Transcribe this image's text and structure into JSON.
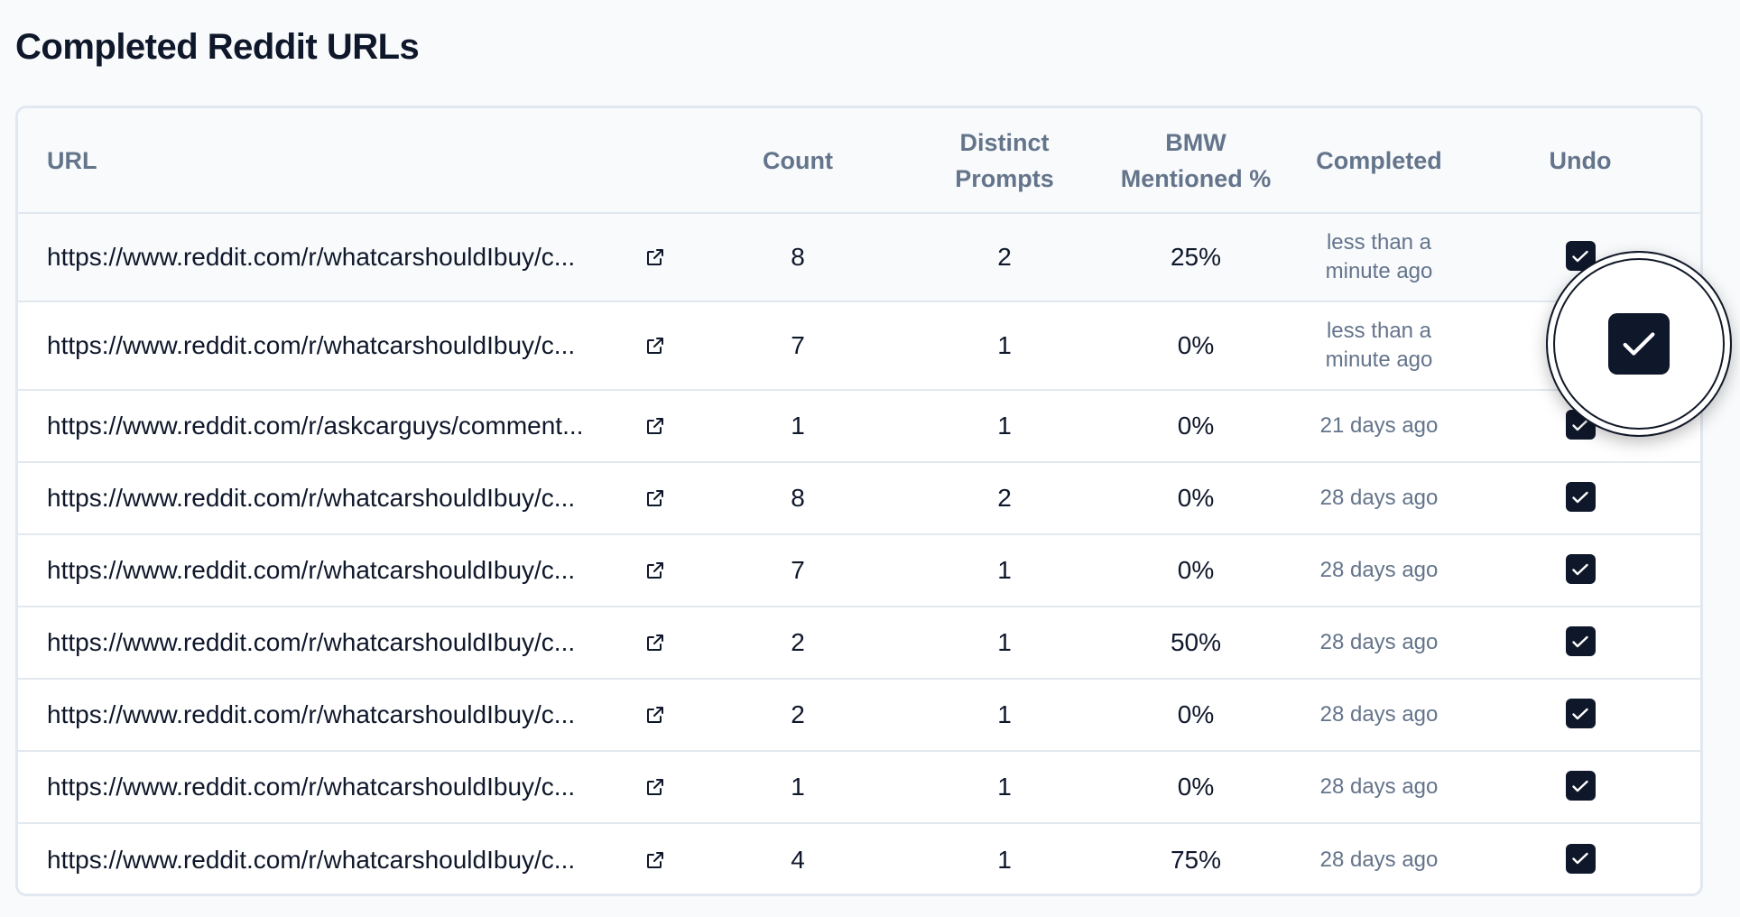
{
  "page": {
    "title": "Completed Reddit URLs"
  },
  "table": {
    "headers": {
      "url": "URL",
      "count": "Count",
      "distinct_line1": "Distinct",
      "distinct_line2": "Prompts",
      "bmw_line1": "BMW",
      "bmw_line2": "Mentioned %",
      "completed": "Completed",
      "undo": "Undo"
    },
    "rows": [
      {
        "url": "https://www.reddit.com/r/whatcarshouldIbuy/c...",
        "count": "8",
        "distinct": "2",
        "bmw": "25%",
        "completed": "less than a minute ago",
        "undo_checked": true
      },
      {
        "url": "https://www.reddit.com/r/whatcarshouldIbuy/c...",
        "count": "7",
        "distinct": "1",
        "bmw": "0%",
        "completed": "less than a minute ago",
        "undo_checked": true
      },
      {
        "url": "https://www.reddit.com/r/askcarguys/comment...",
        "count": "1",
        "distinct": "1",
        "bmw": "0%",
        "completed": "21 days ago",
        "undo_checked": true
      },
      {
        "url": "https://www.reddit.com/r/whatcarshouldIbuy/c...",
        "count": "8",
        "distinct": "2",
        "bmw": "0%",
        "completed": "28 days ago",
        "undo_checked": true
      },
      {
        "url": "https://www.reddit.com/r/whatcarshouldIbuy/c...",
        "count": "7",
        "distinct": "1",
        "bmw": "0%",
        "completed": "28 days ago",
        "undo_checked": true
      },
      {
        "url": "https://www.reddit.com/r/whatcarshouldIbuy/c...",
        "count": "2",
        "distinct": "1",
        "bmw": "50%",
        "completed": "28 days ago",
        "undo_checked": true
      },
      {
        "url": "https://www.reddit.com/r/whatcarshouldIbuy/c...",
        "count": "2",
        "distinct": "1",
        "bmw": "0%",
        "completed": "28 days ago",
        "undo_checked": true
      },
      {
        "url": "https://www.reddit.com/r/whatcarshouldIbuy/c...",
        "count": "1",
        "distinct": "1",
        "bmw": "0%",
        "completed": "28 days ago",
        "undo_checked": true
      },
      {
        "url": "https://www.reddit.com/r/whatcarshouldIbuy/c...",
        "count": "4",
        "distinct": "1",
        "bmw": "75%",
        "completed": "28 days ago",
        "undo_checked": true
      }
    ]
  },
  "icons": {
    "external_link": "external-link-icon",
    "check": "check-icon"
  },
  "colors": {
    "checkbox": "#0f172a",
    "muted_text": "#64748b",
    "border": "#e2e8f0"
  }
}
